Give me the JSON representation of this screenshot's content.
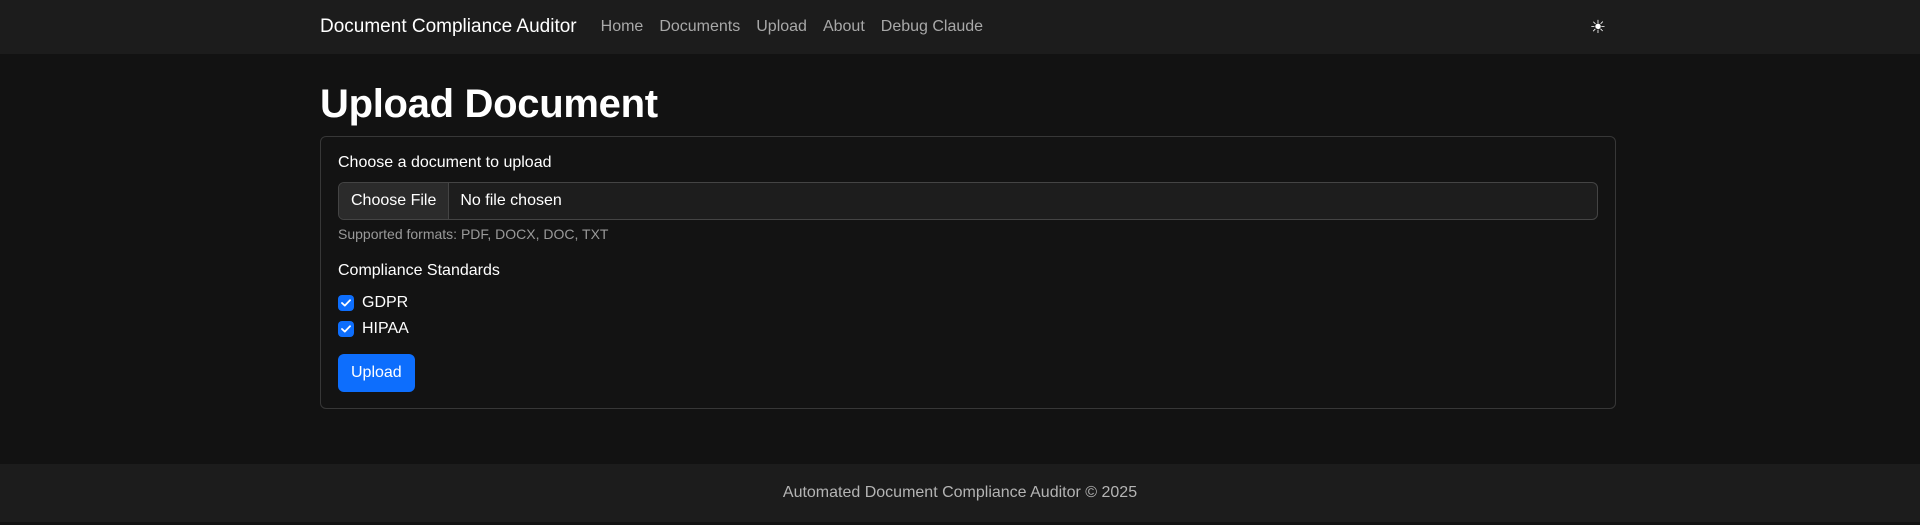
{
  "navbar": {
    "brand": "Document Compliance Auditor",
    "links": [
      "Home",
      "Documents",
      "Upload",
      "About",
      "Debug Claude"
    ],
    "theme_toggle_icon": "sun-icon",
    "theme_toggle_glyph": "☀"
  },
  "main": {
    "title": "Upload Document",
    "file": {
      "label": "Choose a document to upload",
      "button_label": "Choose File",
      "status": "No file chosen",
      "help": "Supported formats: PDF, DOCX, DOC, TXT"
    },
    "standards": {
      "label": "Compliance Standards",
      "options": [
        {
          "label": "GDPR",
          "checked": true
        },
        {
          "label": "HIPAA",
          "checked": true
        }
      ]
    },
    "submit_label": "Upload"
  },
  "footer": {
    "text": "Automated Document Compliance Auditor © 2025"
  },
  "colors": {
    "accent": "#0d6efd",
    "background": "#121212",
    "navbar": "#1c1c1c"
  }
}
